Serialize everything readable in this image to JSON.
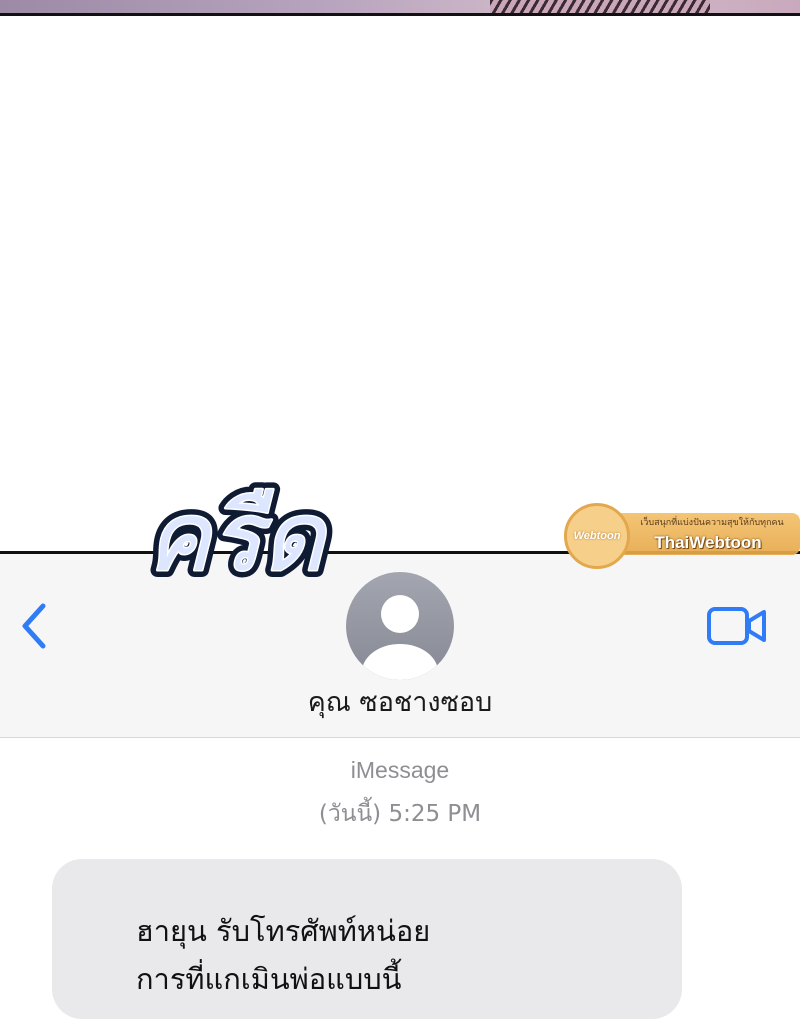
{
  "sfx": {
    "text": "ครืด"
  },
  "watermark": {
    "logo_text": "Webtoon",
    "tagline": "เว็บสนุกที่แบ่งปันความสุขให้กับทุกคน",
    "name": "ThaiWebtoon"
  },
  "header": {
    "back_icon": "chevron-left-icon",
    "video_icon": "video-camera-icon",
    "avatar_icon": "person-avatar-icon",
    "contact_name": "คุณ ซอชางซอบ",
    "accent_color": "#2f7cf6"
  },
  "conversation": {
    "service": "iMessage",
    "timestamp": "(วันนี้) 5:25 PM",
    "messages": [
      {
        "lines": [
          "ฮายุน รับโทรศัพท์หน่อย",
          "การที่แกเมินพ่อแบบนี้"
        ]
      }
    ]
  }
}
